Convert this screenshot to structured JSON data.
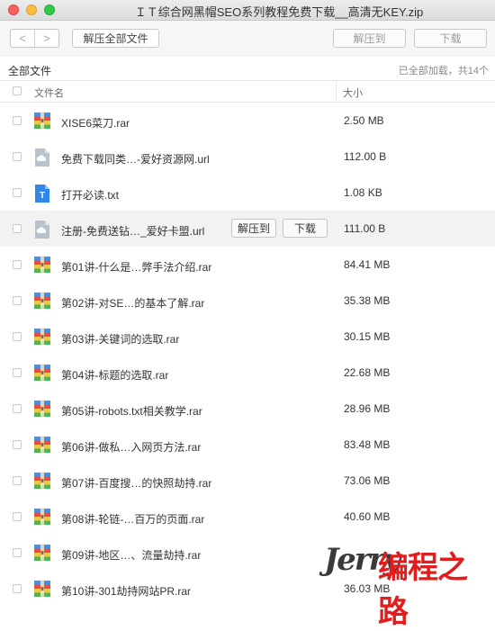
{
  "window": {
    "title": "ＩＴ综合网黑帽SEO系列教程免费下载__高清无KEY.zip"
  },
  "toolbar": {
    "back_label": "<",
    "forward_label": ">",
    "extract_all_label": "解压全部文件",
    "extract_to_label": "解压到",
    "download_label": "下载"
  },
  "subheader": {
    "all_files_label": "全部文件",
    "loaded_status": "已全部加载，共14个"
  },
  "columns": {
    "name": "文件名",
    "size": "大小"
  },
  "row_actions": {
    "extract_to": "解压到",
    "download": "下载"
  },
  "files": [
    {
      "name": "XISE6菜刀.rar",
      "size": "2.50 MB",
      "icon": "rar-archive-icon"
    },
    {
      "name": "免费下载同类…-爱好资源网.url",
      "size": "112.00 B",
      "icon": "url-link-icon"
    },
    {
      "name": "打开必读.txt",
      "size": "1.08 KB",
      "icon": "text-file-icon"
    },
    {
      "name": "注册-免费送钻…_爱好卡盟.url",
      "size": "111.00 B",
      "icon": "url-link-icon"
    },
    {
      "name": "第01讲-什么是…弊手法介绍.rar",
      "size": "84.41 MB",
      "icon": "rar-archive-icon"
    },
    {
      "name": "第02讲-对SE…的基本了解.rar",
      "size": "35.38 MB",
      "icon": "rar-archive-icon"
    },
    {
      "name": "第03讲-关键词的选取.rar",
      "size": "30.15 MB",
      "icon": "rar-archive-icon"
    },
    {
      "name": "第04讲-标题的选取.rar",
      "size": "22.68 MB",
      "icon": "rar-archive-icon"
    },
    {
      "name": "第05讲-robots.txt相关教学.rar",
      "size": "28.96 MB",
      "icon": "rar-archive-icon"
    },
    {
      "name": "第06讲-做私…入网页方法.rar",
      "size": "83.48 MB",
      "icon": "rar-archive-icon"
    },
    {
      "name": "第07讲-百度搜…的快照劫持.rar",
      "size": "73.06 MB",
      "icon": "rar-archive-icon"
    },
    {
      "name": "第08讲-轮链-…百万的页面.rar",
      "size": "40.60 MB",
      "icon": "rar-archive-icon"
    },
    {
      "name": "第09讲-地区…、流量劫持.rar",
      "size": "",
      "icon": "rar-archive-icon"
    },
    {
      "name": "第10讲-301劫持网站PR.rar",
      "size": "36.03 MB",
      "icon": "rar-archive-icon"
    }
  ],
  "watermark": {
    "en": "Jerry",
    "cn": "编程之路"
  },
  "colors": {
    "rar_blue": "#4a90e2",
    "rar_red": "#e94b4b",
    "rar_yellow": "#f5c342",
    "rar_green": "#4cb855",
    "url_gray": "#b8c2cc",
    "txt_blue": "#2f87e8",
    "watermark_red": "#e11d1d"
  }
}
